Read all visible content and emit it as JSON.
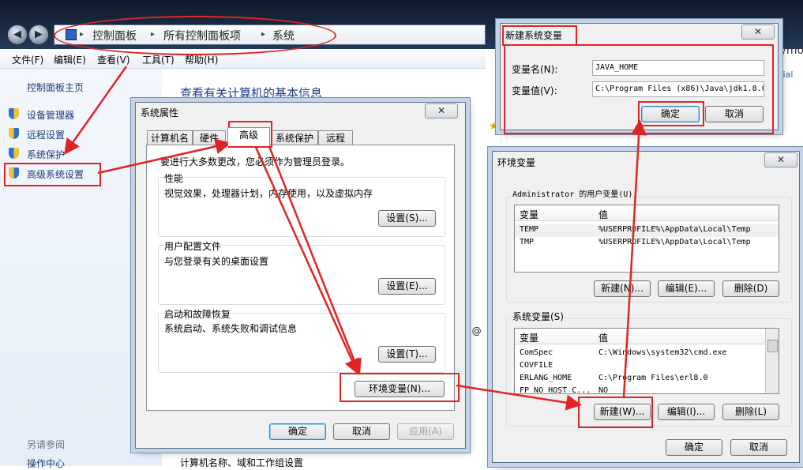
{
  "explorer": {
    "breadcrumb": [
      "控制面板",
      "所有控制面板项",
      "系统"
    ],
    "menu": [
      "文件(F)",
      "编辑(E)",
      "查看(V)",
      "工具(T)",
      "帮助(H)"
    ],
    "left_home": "控制面板主页",
    "left_items": [
      "设备管理器",
      "远程设置",
      "系统保护",
      "高级系统设置"
    ],
    "see_also": "另请参阅",
    "action_center": "操作中心",
    "main_title": "查看有关计算机的基本信息",
    "main_bottom": "计算机名称、域和工作组设置",
    "bg_text_1": "et/mo",
    "bg_text_2": "rial",
    "bg_text_3": "U @"
  },
  "sysprops": {
    "title": "系统属性",
    "close": "✕",
    "tabs": [
      "计算机名",
      "硬件",
      "高级",
      "系统保护",
      "远程"
    ],
    "admin_note": "要进行大多数更改，您必须作为管理员登录。",
    "groups": [
      {
        "label": "性能",
        "desc": "视觉效果，处理器计划，内存使用，以及虚拟内存",
        "button": "设置(S)..."
      },
      {
        "label": "用户配置文件",
        "desc": "与您登录有关的桌面设置",
        "button": "设置(E)..."
      },
      {
        "label": "启动和故障恢复",
        "desc": "系统启动、系统失败和调试信息",
        "button": "设置(T)..."
      }
    ],
    "env_button": "环境变量(N)...",
    "ok": "确定",
    "cancel": "取消",
    "apply": "应用(A)"
  },
  "newvar": {
    "title": "新建系统变量",
    "close": "✕",
    "name_label": "变量名(N):",
    "name_value": "JAVA_HOME",
    "value_label": "变量值(V):",
    "value_value": "C:\\Program Files (x86)\\Java\\jdk1.8.0",
    "ok": "确定",
    "cancel": "取消"
  },
  "envvars": {
    "title": "环境变量",
    "close": "✕",
    "user_section": "Administrator 的用户变量(U)",
    "col_var": "变量",
    "col_val": "值",
    "user_rows": [
      {
        "var": "TEMP",
        "val": "%USERPROFILE%\\AppData\\Local\\Temp"
      },
      {
        "var": "TMP",
        "val": "%USERPROFILE%\\AppData\\Local\\Temp"
      }
    ],
    "user_buttons": [
      "新建(N)...",
      "编辑(E)...",
      "删除(D)"
    ],
    "sys_section": "系统变量(S)",
    "sys_rows": [
      {
        "var": "ComSpec",
        "val": "C:\\Windows\\system32\\cmd.exe"
      },
      {
        "var": "COVFILE",
        "val": ""
      },
      {
        "var": "ERLANG_HOME",
        "val": "C:\\Program Files\\erl8.0"
      },
      {
        "var": "FP_NO_HOST_C...",
        "val": "NO"
      }
    ],
    "sys_buttons": [
      "新建(W)...",
      "编辑(I)...",
      "删除(L)"
    ],
    "ok": "确定",
    "cancel": "取消"
  },
  "colors": {
    "annotation": "#e02424",
    "link": "#1e3b78"
  }
}
